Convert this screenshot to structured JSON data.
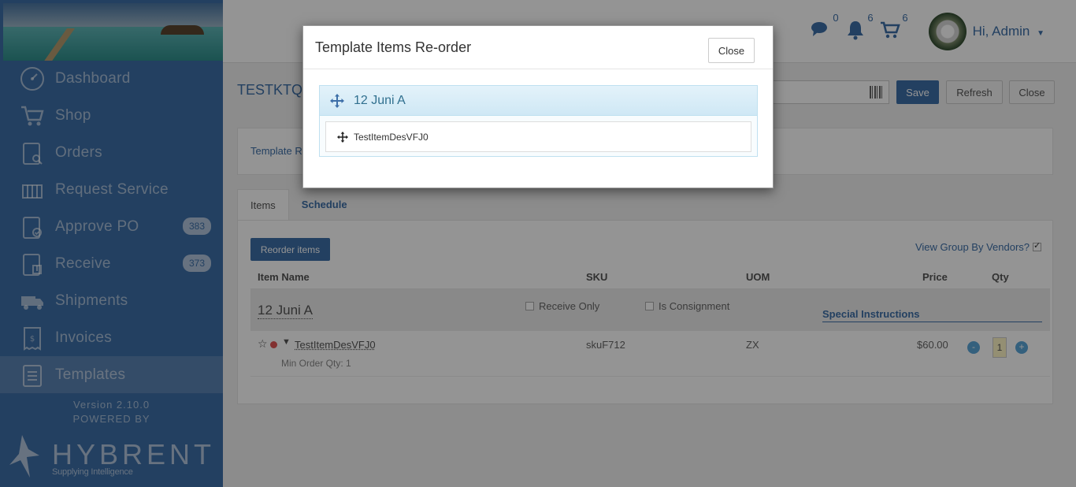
{
  "sidebar": {
    "items": [
      {
        "label": "Dashboard",
        "icon": "dashboard-icon",
        "badge": ""
      },
      {
        "label": "Shop",
        "icon": "cart-icon",
        "badge": ""
      },
      {
        "label": "Orders",
        "icon": "orders-clipboard-icon",
        "badge": ""
      },
      {
        "label": "Request Service",
        "icon": "request-service-icon",
        "badge": ""
      },
      {
        "label": "Approve PO",
        "icon": "approve-clipboard-icon",
        "badge": "383"
      },
      {
        "label": "Receive",
        "icon": "receive-clipboard-icon",
        "badge": "373"
      },
      {
        "label": "Shipments",
        "icon": "truck-icon",
        "badge": ""
      },
      {
        "label": "Invoices",
        "icon": "invoice-icon",
        "badge": ""
      },
      {
        "label": "Templates",
        "icon": "templates-clipboard-icon",
        "badge": "",
        "active": true
      }
    ],
    "version": "Version 2.10.0",
    "powered_by": "POWERED BY",
    "brand": "HYBRENT",
    "tagline": "Supplying Intelligence"
  },
  "topbar": {
    "chat_count": "0",
    "notification_count": "6",
    "cart_count": "6",
    "user_greeting": "Hi, Admin"
  },
  "page": {
    "title": "TESTKTQK",
    "template_link": "Template R",
    "buttons": {
      "save": "Save",
      "refresh": "Refresh",
      "close": "Close"
    },
    "tabs": [
      {
        "label": "Items",
        "active": true
      },
      {
        "label": "Schedule"
      }
    ],
    "reorder_button": "Reorder items",
    "view_group_by_vendors": "View Group By Vendors?",
    "columns": [
      "Item Name",
      "SKU",
      "UOM",
      "Price",
      "Qty"
    ],
    "group": {
      "name": "12 Juni A",
      "receive_only": "Receive Only",
      "is_consignment": "Is Consignment",
      "special_instructions": "Special Instructions"
    },
    "item": {
      "name": "TestItemDesVFJ0",
      "min_order": "Min Order Qty: 1",
      "sku": "skuF712",
      "uom": "ZX",
      "price": "$60.00",
      "qty": "1",
      "minus": "-",
      "plus": "+"
    }
  },
  "modal": {
    "title": "Template Items Re-order",
    "close_label": "Close",
    "group_name": "12 Juni A",
    "items": [
      "TestItemDesVFJ0"
    ]
  },
  "colors": {
    "brand_blue": "#3d6fa8",
    "overlay": "rgba(0,0,0,0.42)",
    "group_header_bg": "#d9eef8"
  }
}
